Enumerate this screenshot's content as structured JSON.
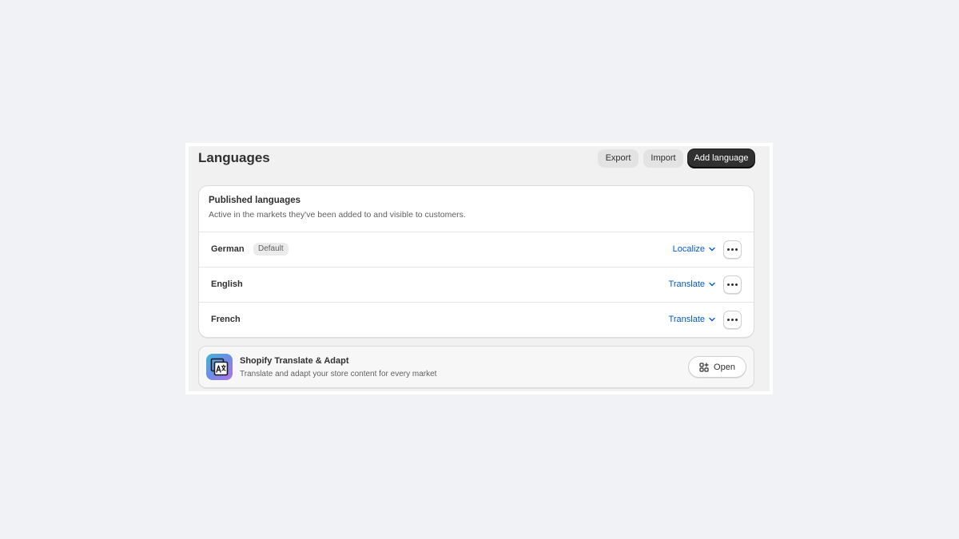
{
  "header": {
    "title": "Languages",
    "export_label": "Export",
    "import_label": "Import",
    "add_label": "Add language"
  },
  "published": {
    "title": "Published languages",
    "subtitle": "Active in the markets they've been added to and visible to customers.",
    "languages": [
      {
        "name": "German",
        "badge": "Default",
        "action": "Localize"
      },
      {
        "name": "English",
        "badge": "",
        "action": "Translate"
      },
      {
        "name": "French",
        "badge": "",
        "action": "Translate"
      }
    ]
  },
  "app": {
    "title": "Shopify Translate & Adapt",
    "subtitle": "Translate and adapt your store content for every market",
    "open_label": "Open",
    "icon": "translate-app-icon"
  },
  "colors": {
    "link": "#005bd3",
    "primary": "#303030",
    "background": "#f1f2f6"
  }
}
